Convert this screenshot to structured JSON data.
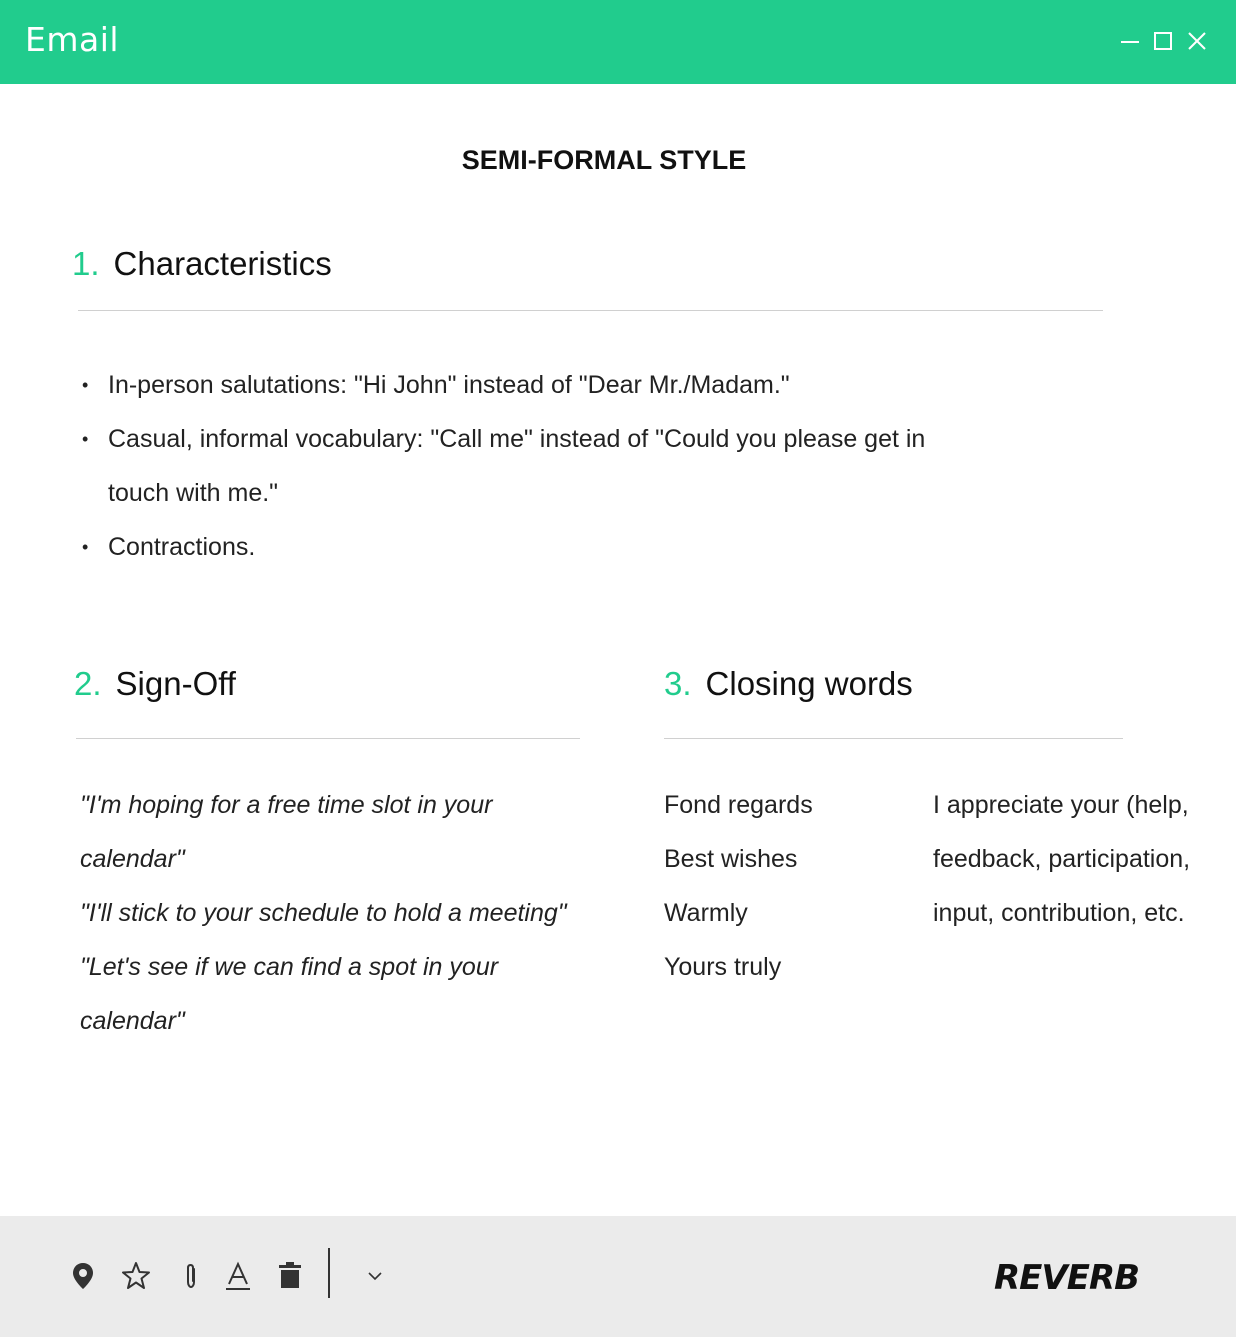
{
  "window": {
    "title": "Email",
    "controls": [
      "minimize-icon",
      "maximize-icon",
      "close-icon"
    ],
    "accent_color": "#21cc8d"
  },
  "document": {
    "title": "SEMI-FORMAL STYLE",
    "sections": [
      {
        "number": "1.",
        "heading": "Characteristics",
        "bullets": [
          "In-person salutations: \"Hi John\" instead of \"Dear Mr./Madam.\"",
          "Casual, informal vocabulary: \"Call me\" instead of \"Could you please get in touch with me.\"",
          "Contractions."
        ]
      },
      {
        "number": "2.",
        "heading": "Sign-Off",
        "lines": [
          "\"I'm hoping for a free time slot in your calendar\"",
          "\"I'll stick to your schedule to hold a meeting\"",
          "\"Let's see if we can find a spot in your calendar\""
        ]
      },
      {
        "number": "3.",
        "heading": "Closing words",
        "column_1": [
          "Fond regards",
          "Best wishes",
          "Warmly",
          "Yours truly"
        ],
        "column_2": "I appreciate your (help, feedback, participation, input, contribution, etc."
      }
    ]
  },
  "toolbar": {
    "icons": [
      "location-pin-icon",
      "star-icon",
      "paperclip-icon",
      "text-format-icon",
      "trash-icon",
      "chevron-down-icon"
    ],
    "logo_text": "REVERB"
  }
}
